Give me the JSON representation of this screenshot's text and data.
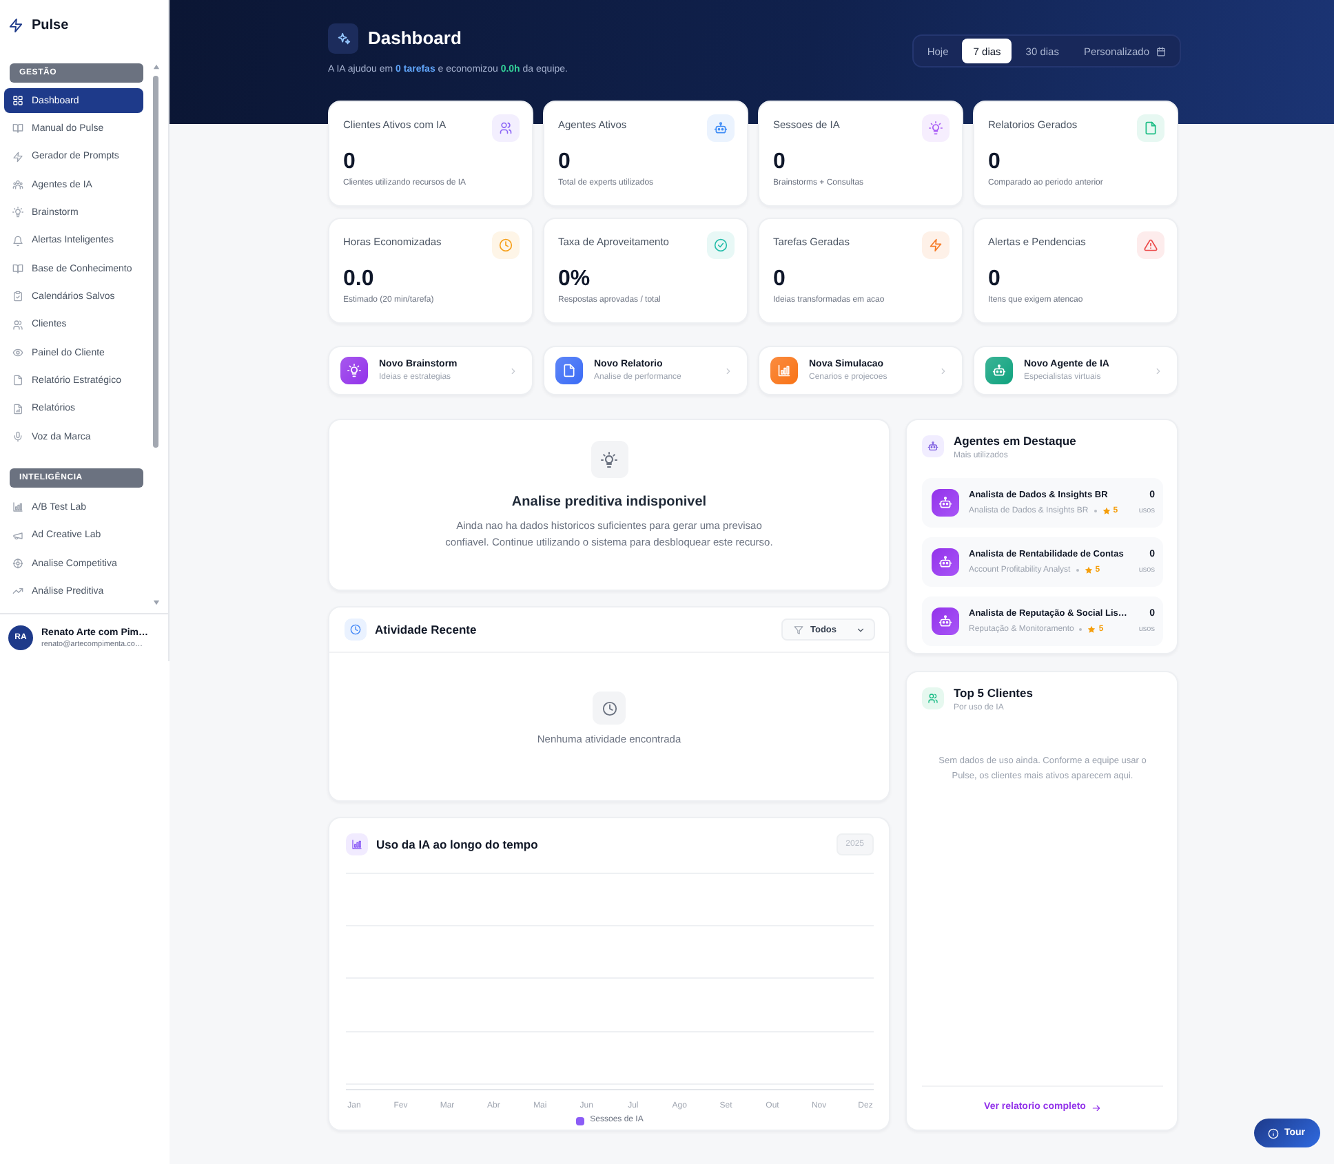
{
  "sidebar": {
    "brand": "Pulse",
    "sections": [
      {
        "title": "GESTÃO",
        "items": [
          {
            "label": "Dashboard",
            "selected": true
          },
          {
            "label": "Manual do Pulse",
            "selected": false
          },
          {
            "label": "Gerador de Prompts",
            "selected": false
          },
          {
            "label": "Agentes de IA",
            "selected": false
          },
          {
            "label": "Brainstorm",
            "selected": false
          },
          {
            "label": "Alertas Inteligentes",
            "selected": false
          },
          {
            "label": "Base de Conhecimento",
            "selected": false
          },
          {
            "label": "Calendários Salvos",
            "selected": false
          },
          {
            "label": "Clientes",
            "selected": false
          },
          {
            "label": "Painel do Cliente",
            "selected": false
          },
          {
            "label": "Relatório Estratégico",
            "selected": false
          },
          {
            "label": "Relatórios",
            "selected": false
          },
          {
            "label": "Voz da Marca",
            "selected": false
          }
        ]
      },
      {
        "title": "INTELIGÊNCIA",
        "items": [
          {
            "label": "A/B Test Lab",
            "selected": false
          },
          {
            "label": "Ad Creative Lab",
            "selected": false
          },
          {
            "label": "Analise Competitiva",
            "selected": false
          },
          {
            "label": "Análise Preditiva",
            "selected": false
          }
        ]
      }
    ],
    "user": {
      "initials": "RA",
      "name": "Renato Arte com Pim…",
      "email": "renato@artecompimenta.co…"
    }
  },
  "header": {
    "title": "Dashboard",
    "summary": "A IA ajudou em **0 tarefas** e economizou **0.0h** da equipe.",
    "periods": [
      {
        "label": "Hoje",
        "kind": "preset",
        "selected": false
      },
      {
        "label": "7 dias",
        "kind": "preset",
        "selected": true
      },
      {
        "label": "30 dias",
        "kind": "preset",
        "selected": false
      },
      {
        "label": "Personalizado",
        "kind": "custom",
        "selected": false
      }
    ]
  },
  "stats": [
    {
      "title": "Clientes Ativos com IA",
      "value": "0",
      "note": "Clientes utilizando recursos de IA",
      "color": "#f3effe"
    },
    {
      "title": "Agentes Ativos",
      "value": "0",
      "note": "Total de experts utilizados",
      "color": "#ebf3fe"
    },
    {
      "title": "Sessoes de IA",
      "value": "0",
      "note": "Brainstorms + Consultas",
      "color": "#f6eefe"
    },
    {
      "title": "Relatorios Gerados",
      "value": "0",
      "note": "Comparado ao periodo anterior",
      "color": "#e7f8f2"
    },
    {
      "title": "Horas Economizadas",
      "value": "0.0",
      "note": "Estimado (20 min/tarefa)",
      "color": "#fef5e7"
    },
    {
      "title": "Taxa de Aproveitamento",
      "value": "0%",
      "note": "Respostas aprovadas / total",
      "color": "#e8f8f6"
    },
    {
      "title": "Tarefas Geradas",
      "value": "0",
      "note": "Ideias transformadas em acao",
      "color": "#fef1e8"
    },
    {
      "title": "Alertas e Pendencias",
      "value": "0",
      "note": "Itens que exigem atencao",
      "color": "#fdecec"
    }
  ],
  "quick_actions": [
    {
      "title": "Novo Brainstorm",
      "subtitle": "Ideias e estrategias",
      "color": "#9333ea"
    },
    {
      "title": "Novo Relatorio",
      "subtitle": "Analise de performance",
      "color": "#3b6cf6"
    },
    {
      "title": "Nova Simulacao",
      "subtitle": "Cenarios e projecoes",
      "color": "#f97316"
    },
    {
      "title": "Novo Agente de IA",
      "subtitle": "Especialistas virtuais",
      "color": "#10a37f"
    }
  ],
  "predictive": {
    "title": "Analise preditiva indisponivel",
    "text": "Ainda nao ha dados historicos suficientes para gerar uma previsao confiavel. Continue utilizando o sistema para desbloquear este recurso."
  },
  "activity": {
    "title": "Atividade Recente",
    "filter": {
      "value": "Todos"
    },
    "empty_text": "Nenhuma atividade encontrada"
  },
  "usage_chart": {
    "title": "Uso da IA ao longo do tempo",
    "year": "2025",
    "months": [
      "Jan",
      "Fev",
      "Mar",
      "Abr",
      "Mai",
      "Jun",
      "Jul",
      "Ago",
      "Set",
      "Out",
      "Nov",
      "Dez"
    ],
    "legend": "Sessoes de IA"
  },
  "featured_agents": {
    "title": "Agentes em Destaque",
    "subtitle": "Mais utilizados",
    "items": [
      {
        "name": "Analista de Dados & Insights BR",
        "role": "Analista de Dados & Insights BR",
        "rating": "5",
        "uses": "0",
        "uses_label": "usos"
      },
      {
        "name": "Analista de Rentabilidade de Contas",
        "role": "Account Profitability Analyst",
        "rating": "5",
        "uses": "0",
        "uses_label": "usos"
      },
      {
        "name": "Analista de Reputação & Social Lis…",
        "role": "Reputação & Monitoramento",
        "rating": "5",
        "uses": "0",
        "uses_label": "usos"
      }
    ]
  },
  "top_clients": {
    "title": "Top 5 Clientes",
    "subtitle": "Por uso de IA",
    "empty_text": "Sem dados de uso ainda. Conforme a equipe usar o Pulse, os clientes mais ativos aparecem aqui.",
    "link": "Ver relatorio completo"
  },
  "tour_button": {
    "label": "Tour"
  }
}
